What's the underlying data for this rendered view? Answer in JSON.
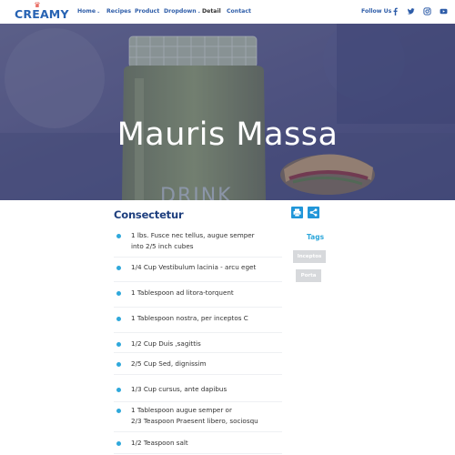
{
  "brand": {
    "name": "CREAMY"
  },
  "nav": {
    "items": [
      {
        "label": "Home",
        "dropdown": true
      },
      {
        "label": "Recipes",
        "dropdown": false
      },
      {
        "label": "Product",
        "dropdown": false
      },
      {
        "label": "Dropdown",
        "dropdown": true
      },
      {
        "label": "Detail",
        "dropdown": false,
        "active": true
      },
      {
        "label": "Contact",
        "dropdown": false
      }
    ],
    "follow_label": "Follow Us",
    "social_icons": [
      "facebook-icon",
      "twitter-icon",
      "instagram-icon",
      "youtube-icon"
    ]
  },
  "hero": {
    "title": "Mauris Massa"
  },
  "recipe": {
    "section_title": "Consectetur",
    "actions": [
      "print-icon",
      "share-icon"
    ],
    "ingredients": [
      "1 lbs. Fusce nec tellus, augue semper\ninto 2/5 inch cubes",
      "1/4 Cup Vestibulum lacinia - arcu eget",
      "1 Tablespoon ad litora-torquent",
      "1 Tablespoon nostra, per inceptos C",
      "1/2 Cup Duis ,sagittis",
      "2/5 Cup Sed, dignissim",
      "1/3 Cup cursus, ante dapibus",
      "1 Tablespoon augue semper or\n2/3 Teaspoon Praesent libero, sociosqu",
      "1/2 Teaspoon salt"
    ]
  },
  "tags": {
    "title": "Tags",
    "items": [
      "Inceptos",
      "Porta"
    ]
  },
  "colors": {
    "brand_blue": "#2763b3",
    "nav_blue": "#2d5ca8",
    "accent_cyan": "#2fa8db",
    "button_blue": "#2196d9",
    "heading_navy": "#1e3f7e",
    "hero_overlay": "#3a3f7a",
    "tag_gray": "#d7d9dc"
  }
}
